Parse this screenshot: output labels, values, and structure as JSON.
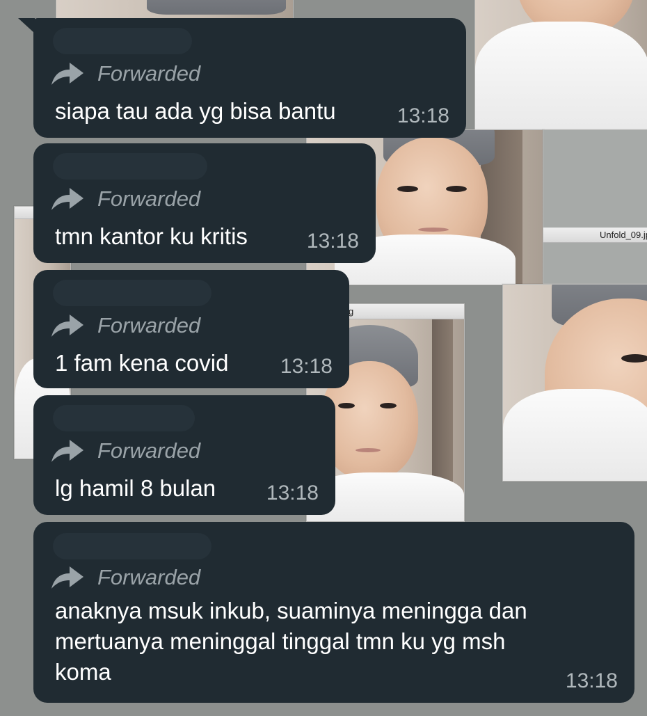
{
  "chat": {
    "forwarded_label": "Forwarded",
    "messages": [
      {
        "text": "siapa tau ada yg bisa bantu",
        "time": "13:18"
      },
      {
        "text": "tmn kantor ku kritis",
        "time": "13:18"
      },
      {
        "text": "1 fam kena covid",
        "time": "13:18"
      },
      {
        "text": "lg hamil 8 bulan",
        "time": "13:18"
      },
      {
        "text": "anaknya msuk inkub, suaminya meningga  dan\nmertuanya meninggal tinggal tmn ku yg msh\nkoma",
        "time": "13:18"
      }
    ]
  },
  "wallpaper": {
    "window_title_1": "Unfold_09.jp",
    "window_title_2": "g"
  },
  "colors": {
    "bubble": "#202b32",
    "forwarded_text": "#9aa3a8",
    "timestamp": "#b0b8bc",
    "background": "#8f9290"
  }
}
